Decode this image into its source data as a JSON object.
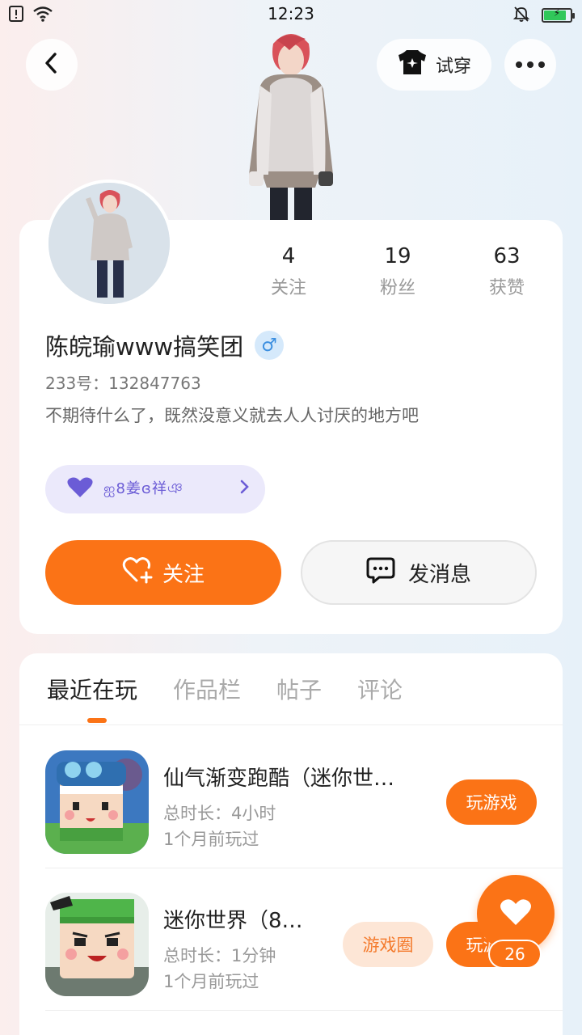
{
  "status_bar": {
    "time": "12:23",
    "icons": [
      "alert-icon",
      "wifi-icon",
      "mute-icon",
      "battery-charging-icon"
    ],
    "battery_percent": 85
  },
  "header": {
    "try_on_label": "试穿",
    "icons": [
      "back-icon",
      "tshirt-icon",
      "more-icon"
    ]
  },
  "profile": {
    "stats": [
      {
        "value": "4",
        "label": "关注"
      },
      {
        "value": "19",
        "label": "粉丝"
      },
      {
        "value": "63",
        "label": "获赞"
      }
    ],
    "name": "陈皖瑜www搞笑团",
    "gender_symbol": "♂",
    "id_text": "233号：132847763",
    "bio": "不期待什么了，既然没意义就去人人讨厌的地方吧",
    "badge_text": "ஐ8姜ɞ祥ঞ",
    "follow_label": "关注",
    "message_label": "发消息"
  },
  "tabs": [
    {
      "label": "最近在玩",
      "active": true
    },
    {
      "label": "作品栏",
      "active": false
    },
    {
      "label": "帖子",
      "active": false
    },
    {
      "label": "评论",
      "active": false
    }
  ],
  "games": [
    {
      "title": "仙气渐变跑酷（迷你世…",
      "playtime": "总时长：4小时",
      "last_played": "1个月前玩过",
      "play_label": "玩游戏"
    },
    {
      "title": "迷你世界（8…",
      "playtime": "总时长：1分钟",
      "last_played": "1个月前玩过",
      "circle_label": "游戏圈",
      "play_label": "玩游戏"
    }
  ],
  "like_fab": {
    "count": "26"
  },
  "colors": {
    "accent": "#fb7316",
    "badge_bg": "#ebe9fb",
    "badge_text": "#6b5cd6",
    "gender": "#3c8fe0"
  }
}
